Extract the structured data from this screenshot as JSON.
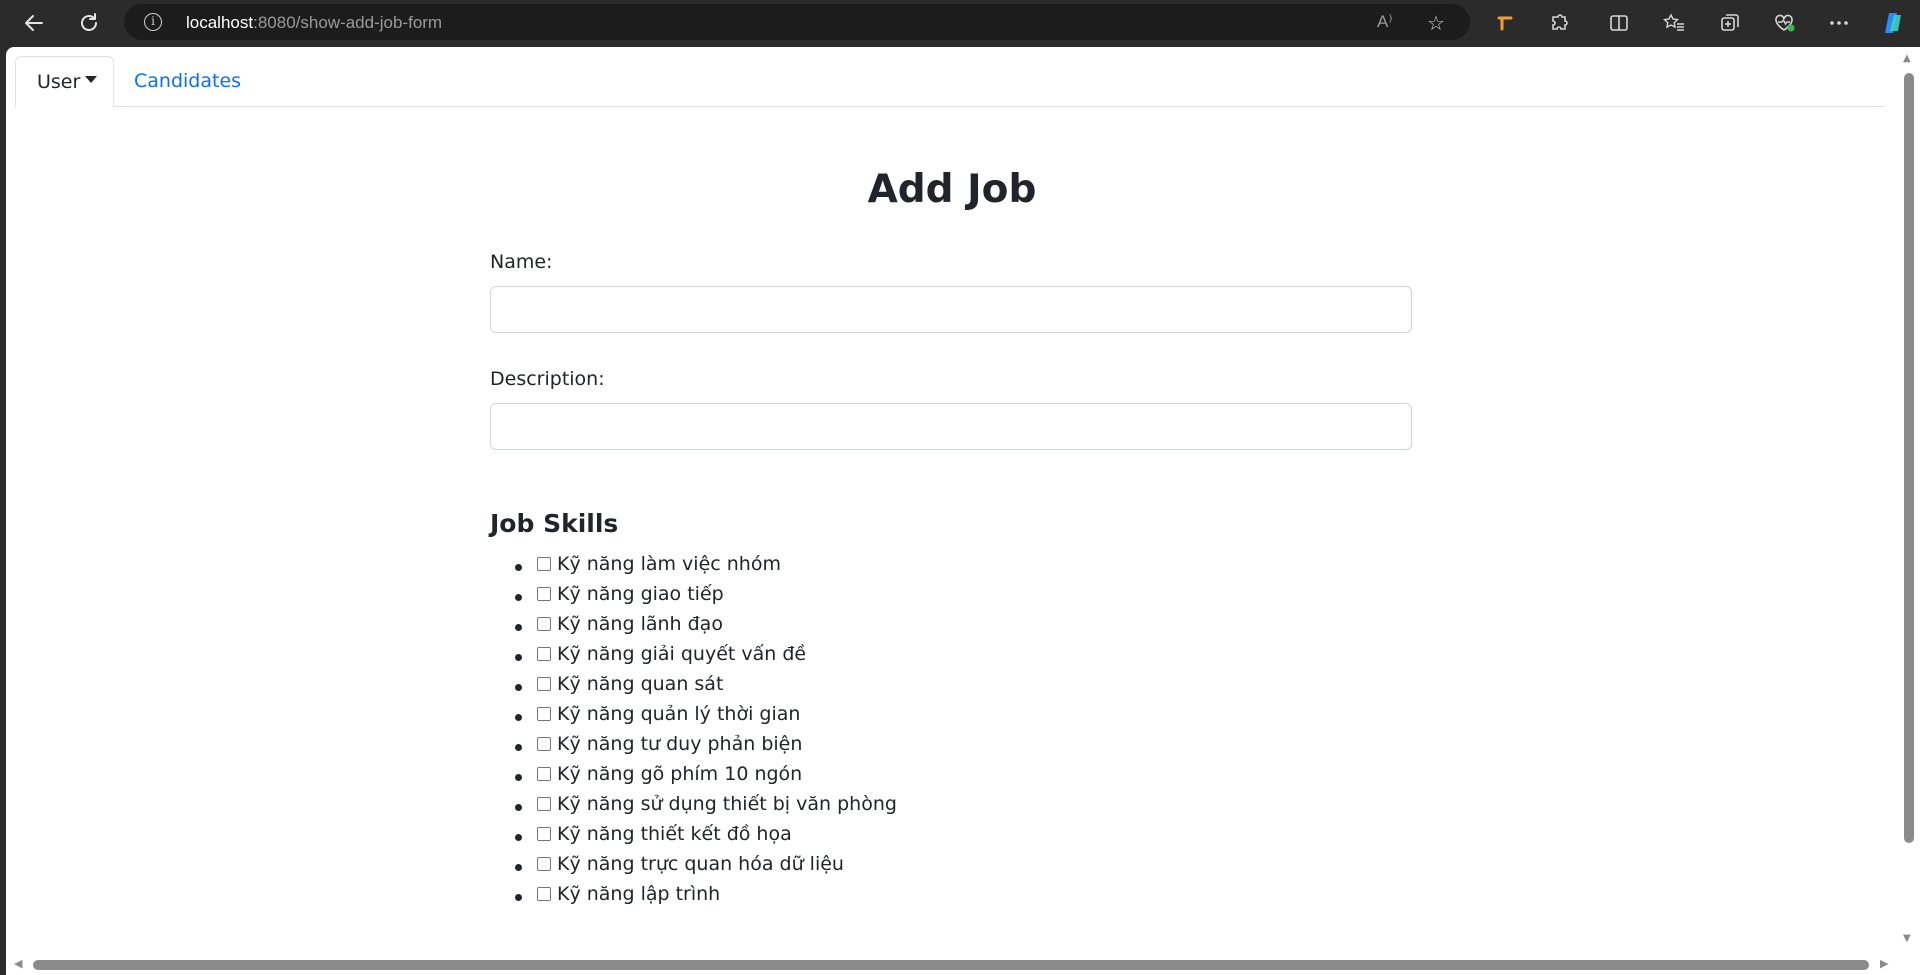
{
  "browser": {
    "url_host": "localhost",
    "url_path": ":8080/show-add-job-form",
    "read_aloud_label": "A⁾"
  },
  "nav": {
    "user_tab": "User",
    "candidates_tab": "Candidates"
  },
  "form": {
    "title": "Add Job",
    "name_label": "Name:",
    "name_value": "",
    "description_label": "Description:",
    "description_value": ""
  },
  "skills": {
    "heading": "Job Skills",
    "items": [
      "Kỹ năng làm việc nhóm",
      "Kỹ năng giao tiếp",
      "Kỹ năng lãnh đạo",
      "Kỹ năng giải quyết vấn đề",
      "Kỹ năng quan sát",
      "Kỹ năng quản lý thời gian",
      "Kỹ năng tư duy phản biện",
      "Kỹ năng gõ phím 10 ngón",
      "Kỹ năng sử dụng thiết bị văn phòng",
      "Kỹ năng thiết kết đồ họa",
      "Kỹ năng trực quan hóa dữ liệu",
      "Kỹ năng lập trình"
    ]
  },
  "colors": {
    "link": "#0d6efd",
    "text": "#212529",
    "border": "#dee2e6"
  }
}
